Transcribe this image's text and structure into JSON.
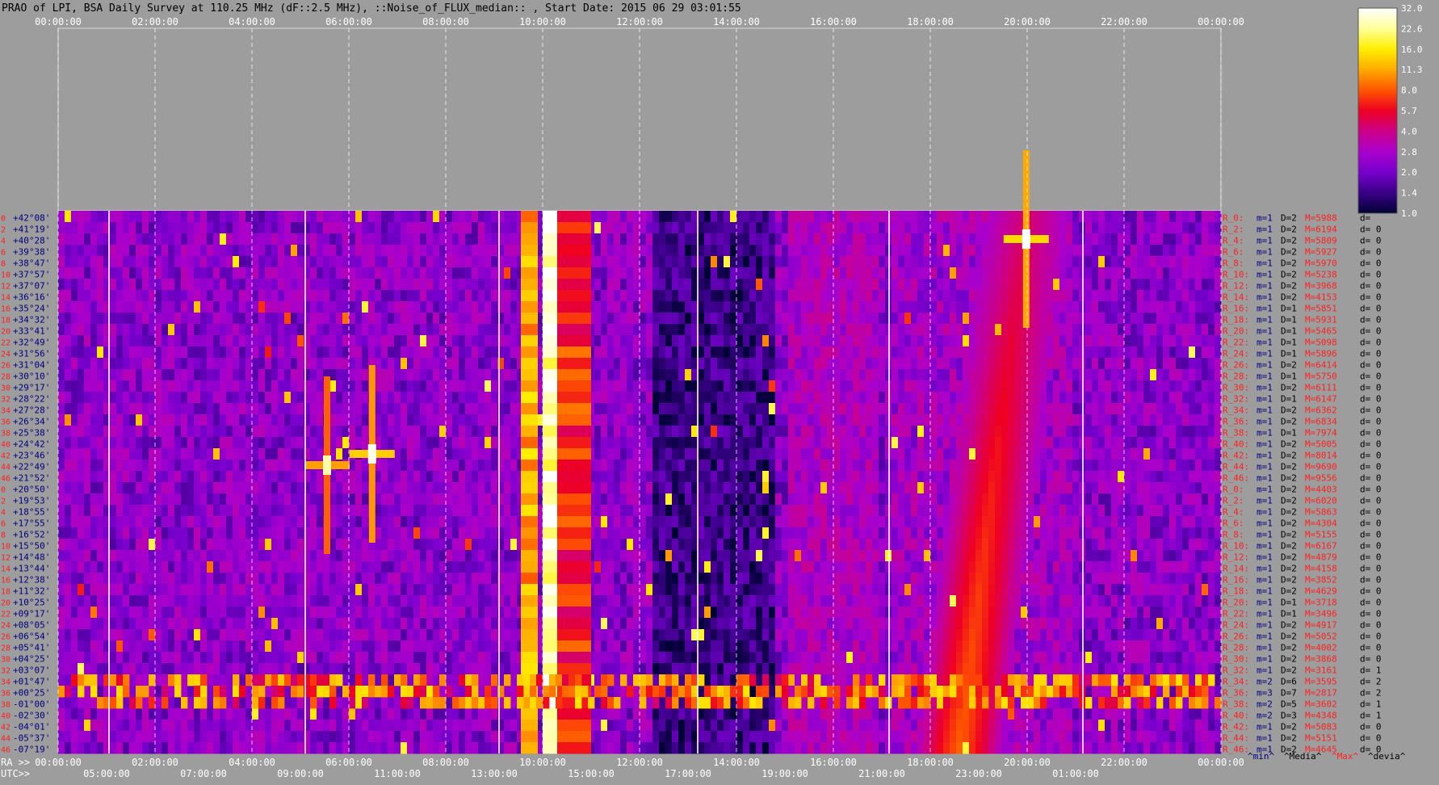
{
  "chart_data": {
    "type": "heatmap",
    "title": "PRAO of LPI, BSA Daily Survey at 110.25 MHz (dF::2.5 MHz), ::Noise_of_FLUX_median:: , Start Date: 2015 06 29 03:01:55",
    "top_time_ticks": [
      "00:00:00",
      "02:00:00",
      "04:00:00",
      "06:00:00",
      "08:00:00",
      "10:00:00",
      "12:00:00",
      "14:00:00",
      "16:00:00",
      "18:00:00",
      "20:00:00",
      "22:00:00",
      "00:00:00"
    ],
    "ra_axis_label": "RA >>",
    "ra_ticks": [
      "00:00:00",
      "02:00:00",
      "04:00:00",
      "06:00:00",
      "08:00:00",
      "10:00:00",
      "12:00:00",
      "14:00:00",
      "16:00:00",
      "18:00:00",
      "20:00:00",
      "22:00:00",
      "00:00:00"
    ],
    "utc_axis_label": "UTC>>",
    "utc_ticks": [
      "05:00:00",
      "07:00:00",
      "09:00:00",
      "11:00:00",
      "13:00:00",
      "15:00:00",
      "17:00:00",
      "19:00:00",
      "21:00:00",
      "23:00:00",
      "01:00:00"
    ],
    "row_index_labels": [
      "0",
      "2",
      "4",
      "6",
      "8",
      "10",
      "12",
      "14",
      "16",
      "18",
      "20",
      "22",
      "24",
      "26",
      "28",
      "30",
      "32",
      "34",
      "36",
      "38",
      "40",
      "42",
      "44",
      "46",
      "0",
      "2",
      "4",
      "6",
      "8",
      "10",
      "12",
      "14",
      "16",
      "18",
      "20",
      "22",
      "24",
      "26",
      "28",
      "30",
      "32",
      "34",
      "36",
      "38",
      "40",
      "42",
      "44",
      "46"
    ],
    "declinations": [
      "+42°08'",
      "+41°19'",
      "+40°28'",
      "+39°38'",
      "+38°47'",
      "+37°57'",
      "+37°07'",
      "+36°16'",
      "+35°24'",
      "+34°32'",
      "+33°41'",
      "+32°49'",
      "+31°56'",
      "+31°04'",
      "+30°10'",
      "+29°17'",
      "+28°22'",
      "+27°28'",
      "+26°34'",
      "+25°38'",
      "+24°42'",
      "+23°46'",
      "+22°49'",
      "+21°52'",
      "+20°50'",
      "+19°53'",
      "+18°55'",
      "+17°55'",
      "+16°52'",
      "+15°50'",
      "+14°48'",
      "+13°44'",
      "+12°38'",
      "+11°32'",
      "+10°25'",
      "+09°17'",
      "+08°05'",
      "+06°54'",
      "+05°41'",
      "+04°25'",
      "+03°07'",
      "+01°47'",
      "+00°25'",
      "-01°00'",
      "-02°30'",
      "-04°01'",
      "-05°37'",
      "-07°19'"
    ],
    "row_stats": [
      {
        "r": "R_0:",
        "m": "m=1",
        "D": "D=2",
        "M": "M=5988",
        "d": "d="
      },
      {
        "r": "R_2:",
        "m": "m=1",
        "D": "D=2",
        "M": "M=6194",
        "d": "d= 0"
      },
      {
        "r": "R_4:",
        "m": "m=1",
        "D": "D=2",
        "M": "M=5809",
        "d": "d= 0"
      },
      {
        "r": "R_6:",
        "m": "m=1",
        "D": "D=2",
        "M": "M=5927",
        "d": "d= 0"
      },
      {
        "r": "R_8:",
        "m": "m=1",
        "D": "D=2",
        "M": "M=5970",
        "d": "d= 0"
      },
      {
        "r": "R_10:",
        "m": "m=1",
        "D": "D=2",
        "M": "M=5238",
        "d": "d= 0"
      },
      {
        "r": "R_12:",
        "m": "m=1",
        "D": "D=2",
        "M": "M=3968",
        "d": "d= 0"
      },
      {
        "r": "R_14:",
        "m": "m=1",
        "D": "D=2",
        "M": "M=4153",
        "d": "d= 0"
      },
      {
        "r": "R_16:",
        "m": "m=1",
        "D": "D=1",
        "M": "M=5851",
        "d": "d= 0"
      },
      {
        "r": "R_18:",
        "m": "m=1",
        "D": "D=1",
        "M": "M=5931",
        "d": "d= 0"
      },
      {
        "r": "R_20:",
        "m": "m=1",
        "D": "D=1",
        "M": "M=5465",
        "d": "d= 0"
      },
      {
        "r": "R_22:",
        "m": "m=1",
        "D": "D=1",
        "M": "M=5098",
        "d": "d= 0"
      },
      {
        "r": "R_24:",
        "m": "m=1",
        "D": "D=1",
        "M": "M=5896",
        "d": "d= 0"
      },
      {
        "r": "R_26:",
        "m": "m=1",
        "D": "D=2",
        "M": "M=6414",
        "d": "d= 0"
      },
      {
        "r": "R_28:",
        "m": "m=1",
        "D": "D=1",
        "M": "M=5750",
        "d": "d= 0"
      },
      {
        "r": "R_30:",
        "m": "m=1",
        "D": "D=2",
        "M": "M=6111",
        "d": "d= 0"
      },
      {
        "r": "R_32:",
        "m": "m=1",
        "D": "D=1",
        "M": "M=6147",
        "d": "d= 0"
      },
      {
        "r": "R_34:",
        "m": "m=1",
        "D": "D=2",
        "M": "M=6362",
        "d": "d= 0"
      },
      {
        "r": "R_36:",
        "m": "m=1",
        "D": "D=2",
        "M": "M=6834",
        "d": "d= 0"
      },
      {
        "r": "R_38:",
        "m": "m=1",
        "D": "D=1",
        "M": "M=7974",
        "d": "d= 0"
      },
      {
        "r": "R_40:",
        "m": "m=1",
        "D": "D=2",
        "M": "M=5005",
        "d": "d= 0"
      },
      {
        "r": "R_42:",
        "m": "m=1",
        "D": "D=2",
        "M": "M=8014",
        "d": "d= 0"
      },
      {
        "r": "R_44:",
        "m": "m=1",
        "D": "D=2",
        "M": "M=9690",
        "d": "d= 0"
      },
      {
        "r": "R_46:",
        "m": "m=1",
        "D": "D=2",
        "M": "M=9556",
        "d": "d= 0"
      },
      {
        "r": "R_0:",
        "m": "m=1",
        "D": "D=2",
        "M": "M=4403",
        "d": "d= 0"
      },
      {
        "r": "R_2:",
        "m": "m=1",
        "D": "D=2",
        "M": "M=6020",
        "d": "d= 0"
      },
      {
        "r": "R_4:",
        "m": "m=1",
        "D": "D=2",
        "M": "M=5863",
        "d": "d= 0"
      },
      {
        "r": "R_6:",
        "m": "m=1",
        "D": "D=2",
        "M": "M=4304",
        "d": "d= 0"
      },
      {
        "r": "R_8:",
        "m": "m=1",
        "D": "D=2",
        "M": "M=5155",
        "d": "d= 0"
      },
      {
        "r": "R_10:",
        "m": "m=1",
        "D": "D=2",
        "M": "M=6167",
        "d": "d= 0"
      },
      {
        "r": "R_12:",
        "m": "m=1",
        "D": "D=2",
        "M": "M=4879",
        "d": "d= 0"
      },
      {
        "r": "R_14:",
        "m": "m=1",
        "D": "D=2",
        "M": "M=4158",
        "d": "d= 0"
      },
      {
        "r": "R_16:",
        "m": "m=1",
        "D": "D=2",
        "M": "M=3852",
        "d": "d= 0"
      },
      {
        "r": "R_18:",
        "m": "m=1",
        "D": "D=2",
        "M": "M=4629",
        "d": "d= 0"
      },
      {
        "r": "R_20:",
        "m": "m=1",
        "D": "D=1",
        "M": "M=3718",
        "d": "d= 0"
      },
      {
        "r": "R_22:",
        "m": "m=1",
        "D": "D=1",
        "M": "M=3496",
        "d": "d= 0"
      },
      {
        "r": "R_24:",
        "m": "m=1",
        "D": "D=2",
        "M": "M=4917",
        "d": "d= 0"
      },
      {
        "r": "R_26:",
        "m": "m=1",
        "D": "D=2",
        "M": "M=5052",
        "d": "d= 0"
      },
      {
        "r": "R_28:",
        "m": "m=1",
        "D": "D=2",
        "M": "M=4002",
        "d": "d= 0"
      },
      {
        "r": "R_30:",
        "m": "m=1",
        "D": "D=2",
        "M": "M=3868",
        "d": "d= 0"
      },
      {
        "r": "R_32:",
        "m": "m=1",
        "D": "D=2",
        "M": "M=3161",
        "d": "d= 1"
      },
      {
        "r": "R_34:",
        "m": "m=2",
        "D": "D=6",
        "M": "M=3595",
        "d": "d= 2"
      },
      {
        "r": "R_36:",
        "m": "m=3",
        "D": "D=7",
        "M": "M=2817",
        "d": "d= 2"
      },
      {
        "r": "R_38:",
        "m": "m=2",
        "D": "D=5",
        "M": "M=3602",
        "d": "d= 1"
      },
      {
        "r": "R_40:",
        "m": "m=2",
        "D": "D=3",
        "M": "M=4348",
        "d": "d= 1"
      },
      {
        "r": "R_42:",
        "m": "m=1",
        "D": "D=2",
        "M": "M=5083",
        "d": "d= 0"
      },
      {
        "r": "R_44:",
        "m": "m=1",
        "D": "D=2",
        "M": "M=5151",
        "d": "d= 0"
      },
      {
        "r": "R_46:",
        "m": "m=1",
        "D": "D=2",
        "M": "M=4645",
        "d": "d= 0"
      }
    ],
    "stat_legend": [
      {
        "label": "^min^",
        "color": "#000080"
      },
      {
        "label": "^Media^",
        "color": "#000000"
      },
      {
        "label": "^Max^",
        "color": "#ff2020"
      },
      {
        "label": "^devia^",
        "color": "#000000"
      }
    ],
    "colorbar_ticks": [
      "32.0",
      "22.6",
      "16.0",
      "11.3",
      "8.0",
      "5.7",
      "4.0",
      "2.8",
      "2.0",
      "1.4",
      "1.0"
    ],
    "colorbar_colors": [
      "#ffffff",
      "#ffff99",
      "#ffee00",
      "#ffaa00",
      "#ff5500",
      "#ee0022",
      "#cc0088",
      "#aa00cc",
      "#7700cc",
      "#3a0088",
      "#000033"
    ],
    "hours_span": 24,
    "rows_count": 48,
    "features": [
      {
        "name": "interference-hours-10.0-10.3",
        "hour_from": 10.0,
        "hour_to": 10.3,
        "intensity": 32
      },
      {
        "name": "interference-hours-9.55-9.9",
        "hour_from": 9.55,
        "hour_to": 9.9,
        "intensity": 14
      },
      {
        "name": "interference-hours-10.3-11.0",
        "hour_from": 10.3,
        "hour_to": 11.0,
        "intensity": 8
      },
      {
        "name": "horizontal-band-dec-+01-47-to--01-00",
        "row_from": 41,
        "row_to": 43,
        "intensity": 14
      },
      {
        "name": "source-ra-06-30-dec-+23",
        "hour": 6.48,
        "row": 21,
        "intensity": 30
      },
      {
        "name": "source-ra-05-35-dec-+22",
        "hour": 5.55,
        "row": 22,
        "intensity": 24
      },
      {
        "name": "source-ra-19-59-dec-+40",
        "hour": 19.98,
        "row": 2,
        "intensity": 32
      },
      {
        "name": "galactic-plane-track",
        "hour_top": 20.0,
        "hour_bottom": 18.6,
        "intensity": 9
      }
    ]
  }
}
